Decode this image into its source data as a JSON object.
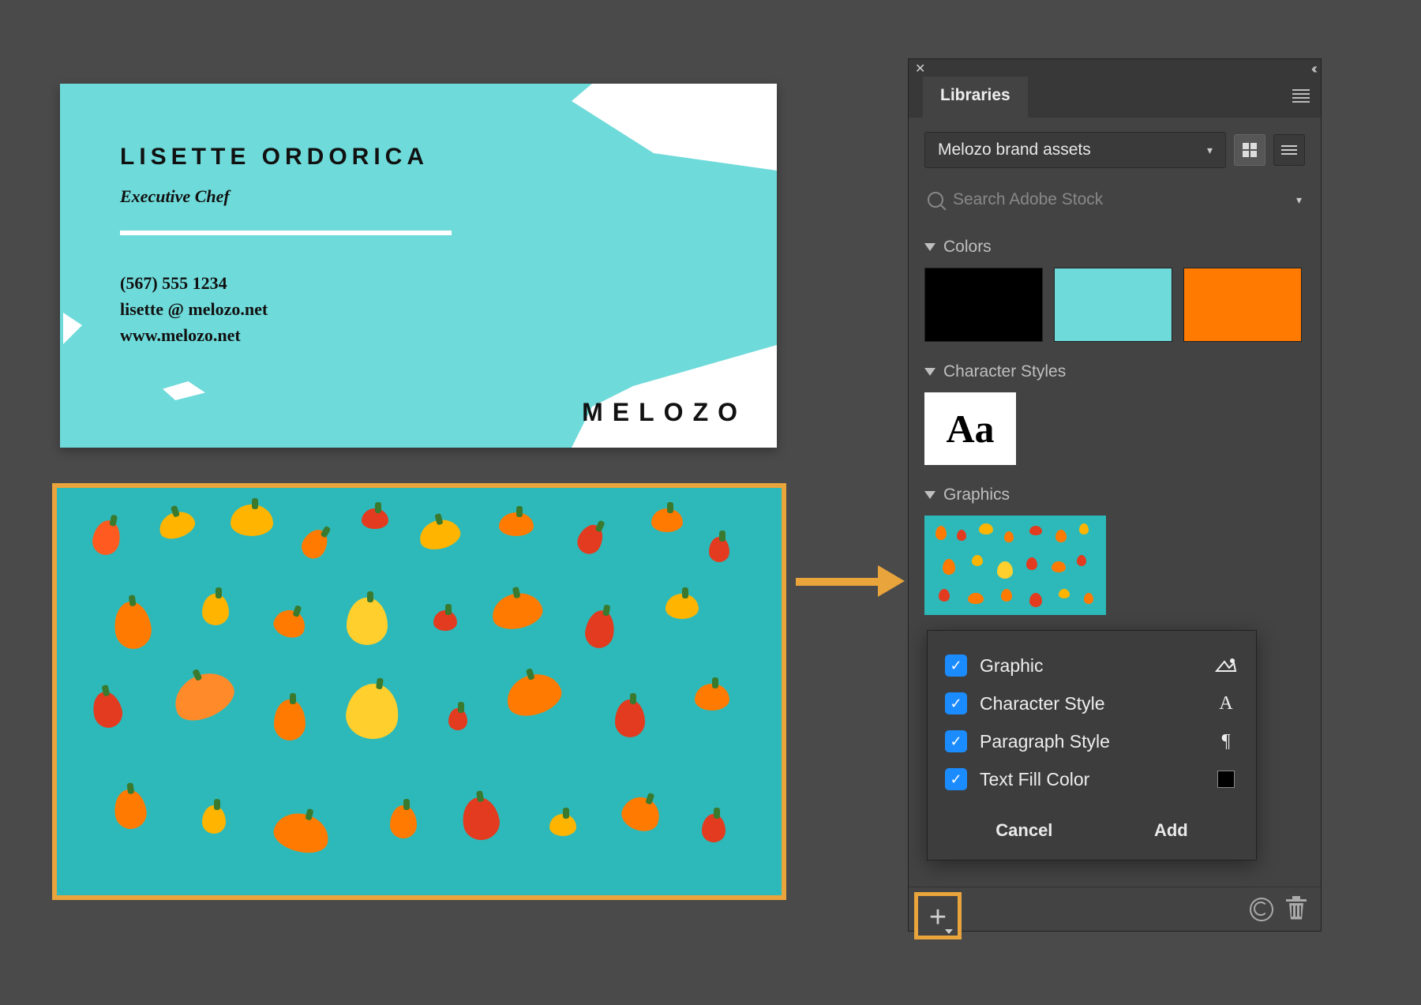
{
  "card": {
    "name": "LISETTE ORDORICA",
    "title": "Executive Chef",
    "phone": "(567) 555 1234",
    "email": "lisette @ melozo.net",
    "web": "www.melozo.net",
    "logo": "MELOZO"
  },
  "panel": {
    "tab": "Libraries",
    "library_name": "Melozo brand assets",
    "search_placeholder": "Search Adobe Stock",
    "sections": {
      "colors": "Colors",
      "charstyles": "Character Styles",
      "graphics": "Graphics"
    },
    "charstyle_tile": "Aa",
    "swatches": [
      "#000000",
      "#6fdada",
      "#ff7a00"
    ]
  },
  "popup": {
    "options": [
      {
        "label": "Graphic",
        "icon": "graphic",
        "checked": true
      },
      {
        "label": "Character Style",
        "icon": "A",
        "checked": true
      },
      {
        "label": "Paragraph Style",
        "icon": "pilcrow",
        "checked": true
      },
      {
        "label": "Text Fill Color",
        "icon": "swatch",
        "checked": true
      }
    ],
    "cancel": "Cancel",
    "add": "Add"
  }
}
